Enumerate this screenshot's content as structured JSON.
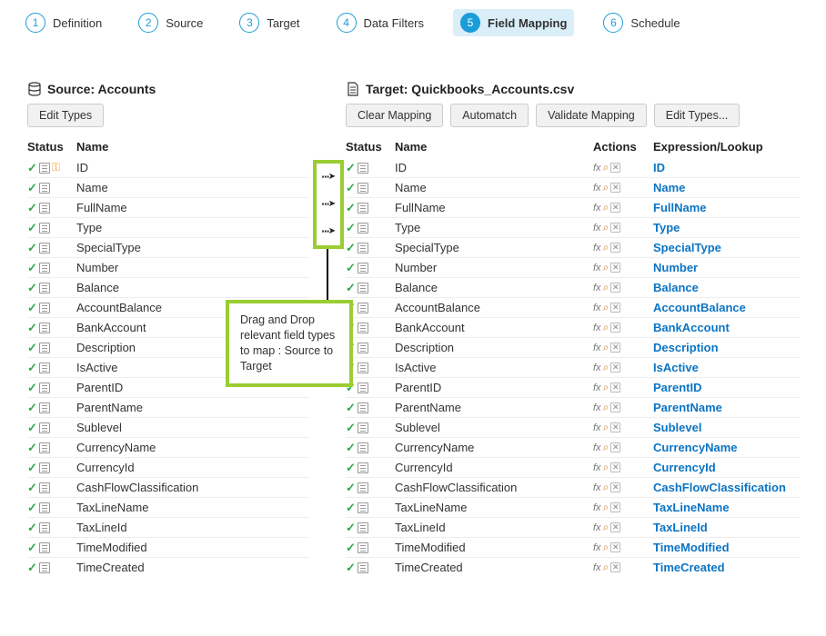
{
  "wizard": {
    "steps": [
      {
        "num": "1",
        "label": "Definition"
      },
      {
        "num": "2",
        "label": "Source"
      },
      {
        "num": "3",
        "label": "Target"
      },
      {
        "num": "4",
        "label": "Data Filters"
      },
      {
        "num": "5",
        "label": "Field Mapping"
      },
      {
        "num": "6",
        "label": "Schedule"
      }
    ],
    "active_index": 4
  },
  "source": {
    "title": "Source: Accounts",
    "buttons": {
      "edit_types": "Edit Types"
    },
    "headers": {
      "status": "Status",
      "name": "Name"
    },
    "fields": [
      {
        "name": "ID",
        "key": true
      },
      {
        "name": "Name"
      },
      {
        "name": "FullName"
      },
      {
        "name": "Type"
      },
      {
        "name": "SpecialType"
      },
      {
        "name": "Number"
      },
      {
        "name": "Balance"
      },
      {
        "name": "AccountBalance"
      },
      {
        "name": "BankAccount"
      },
      {
        "name": "Description"
      },
      {
        "name": "IsActive"
      },
      {
        "name": "ParentID"
      },
      {
        "name": "ParentName"
      },
      {
        "name": "Sublevel"
      },
      {
        "name": "CurrencyName"
      },
      {
        "name": "CurrencyId"
      },
      {
        "name": "CashFlowClassification"
      },
      {
        "name": "TaxLineName"
      },
      {
        "name": "TaxLineId"
      },
      {
        "name": "TimeModified"
      },
      {
        "name": "TimeCreated"
      }
    ]
  },
  "target": {
    "title": "Target: Quickbooks_Accounts.csv",
    "buttons": {
      "clear": "Clear Mapping",
      "automatch": "Automatch",
      "validate": "Validate Mapping",
      "edit_types": "Edit Types..."
    },
    "headers": {
      "status": "Status",
      "name": "Name",
      "actions": "Actions",
      "expr": "Expression/Lookup"
    },
    "fields": [
      {
        "name": "ID",
        "expr": "ID"
      },
      {
        "name": "Name",
        "expr": "Name"
      },
      {
        "name": "FullName",
        "expr": "FullName"
      },
      {
        "name": "Type",
        "expr": "Type"
      },
      {
        "name": "SpecialType",
        "expr": "SpecialType"
      },
      {
        "name": "Number",
        "expr": "Number"
      },
      {
        "name": "Balance",
        "expr": "Balance"
      },
      {
        "name": "AccountBalance",
        "expr": "AccountBalance"
      },
      {
        "name": "BankAccount",
        "expr": "BankAccount"
      },
      {
        "name": "Description",
        "expr": "Description"
      },
      {
        "name": "IsActive",
        "expr": "IsActive"
      },
      {
        "name": "ParentID",
        "expr": "ParentID"
      },
      {
        "name": "ParentName",
        "expr": "ParentName"
      },
      {
        "name": "Sublevel",
        "expr": "Sublevel"
      },
      {
        "name": "CurrencyName",
        "expr": "CurrencyName"
      },
      {
        "name": "CurrencyId",
        "expr": "CurrencyId"
      },
      {
        "name": "CashFlowClassification",
        "expr": "CashFlowClassification"
      },
      {
        "name": "TaxLineName",
        "expr": "TaxLineName"
      },
      {
        "name": "TaxLineId",
        "expr": "TaxLineId"
      },
      {
        "name": "TimeModified",
        "expr": "TimeModified"
      },
      {
        "name": "TimeCreated",
        "expr": "TimeCreated"
      }
    ]
  },
  "callout": {
    "text": "Drag and Drop relevant field types to map : Source to Target"
  },
  "icons": {
    "check": "✓",
    "key": "🔑",
    "fx": "fx",
    "magnifier": "🔍",
    "delete": "✕",
    "dot_arrow": "⋯➤"
  },
  "colors": {
    "accent": "#1b9dd9",
    "callout_border": "#9acd32",
    "link": "#0b74c4",
    "check": "#2fa84f"
  }
}
